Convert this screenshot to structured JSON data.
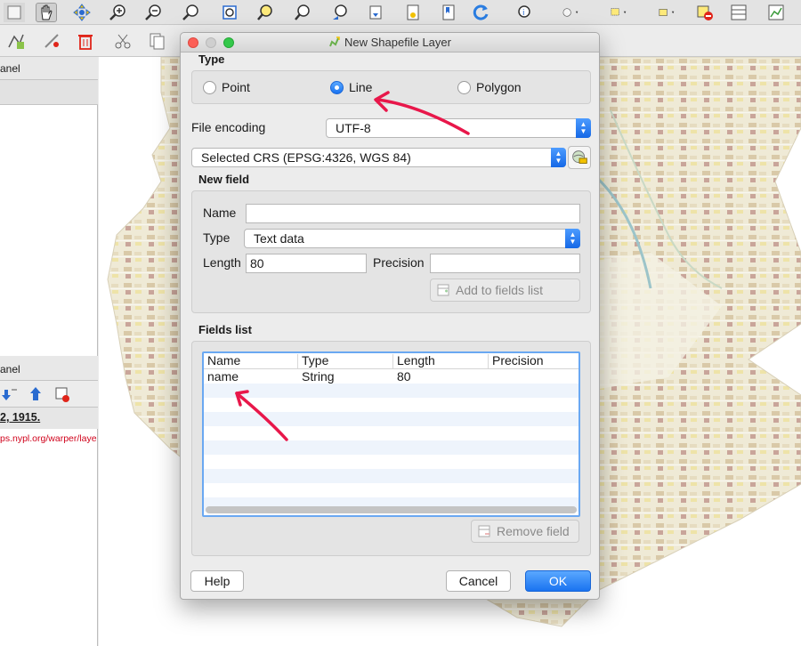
{
  "app": {
    "left_panel": {
      "top_panel_title": "anel",
      "bottom_panel_title": "anel",
      "date_text": "2, 1915.",
      "url_text": "ps.nypl.org/warper/laye"
    }
  },
  "dialog": {
    "title": "New Shapefile Layer",
    "type_group": {
      "label": "Type",
      "options": [
        {
          "label": "Point",
          "selected": false
        },
        {
          "label": "Line",
          "selected": true
        },
        {
          "label": "Polygon",
          "selected": false
        }
      ]
    },
    "file_encoding": {
      "label": "File encoding",
      "value": "UTF-8"
    },
    "crs": {
      "value": "Selected CRS (EPSG:4326, WGS 84)"
    },
    "new_field": {
      "label": "New field",
      "name_label": "Name",
      "name_value": "",
      "type_label": "Type",
      "type_value": "Text data",
      "length_label": "Length",
      "length_value": "80",
      "precision_label": "Precision",
      "precision_value": "",
      "add_button": "Add to fields list"
    },
    "fields_list": {
      "label": "Fields list",
      "columns": [
        "Name",
        "Type",
        "Length",
        "Precision"
      ],
      "rows": [
        {
          "name": "name",
          "type": "String",
          "length": "80",
          "precision": ""
        }
      ],
      "remove_button": "Remove field"
    },
    "buttons": {
      "help": "Help",
      "cancel": "Cancel",
      "ok": "OK"
    }
  },
  "colors": {
    "accent": "#1a73f0",
    "annotation": "#e8174a",
    "url": "#d0021b"
  },
  "icons": [
    "pan-hand-icon",
    "zoom-in-icon",
    "zoom-out-icon",
    "refresh-icon",
    "delete-icon",
    "cut-icon",
    "copy-icon",
    "crs-select-icon",
    "add-field-icon",
    "remove-field-icon"
  ]
}
